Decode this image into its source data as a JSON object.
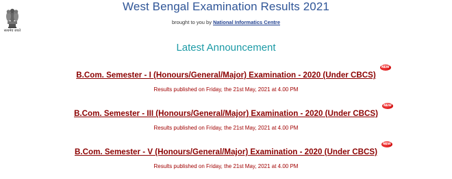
{
  "header": {
    "emblem_caption": "सत्यमेव जयते",
    "title": "West Bengal Examination Results 2021",
    "credit_prefix": "brought to you by",
    "credit_link": "National Informatics Centre"
  },
  "section_title": "Latest Announcement",
  "announcements": [
    {
      "title": "B.Com. Semester - I (Honours/General/Major) Examination - 2020 (Under CBCS)",
      "badge": "NEW",
      "note": "Results published on Friday, the 21st May, 2021 at 4.00 PM"
    },
    {
      "title": "B.Com. Semester - III (Honours/General/Major) Examination - 2020 (Under CBCS)",
      "badge": "NEW",
      "note": "Results published on Friday, the 21st May, 2021 at 4.00 PM"
    },
    {
      "title": "B.Com. Semester - V (Honours/General/Major) Examination - 2020 (Under CBCS)",
      "badge": "NEW",
      "note": "Results published on Friday, the 21st May, 2021 at 4.00 PM"
    }
  ],
  "colors": {
    "title": "#2f5597",
    "section": "#1b9aa6",
    "link": "#8b0000",
    "badge": "#c40000"
  }
}
